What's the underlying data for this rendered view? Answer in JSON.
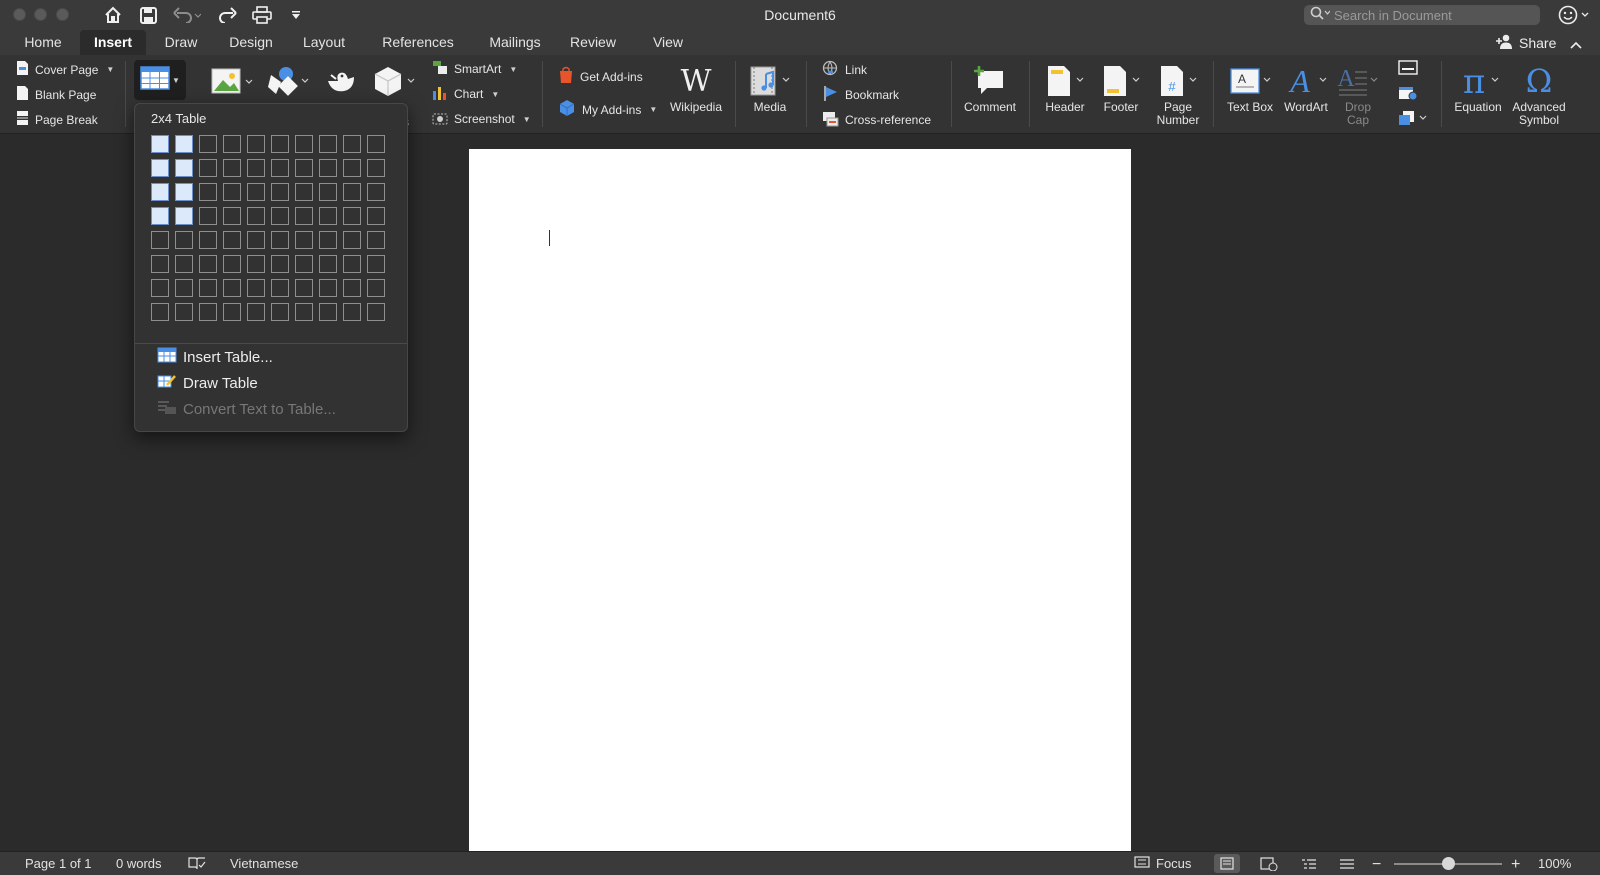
{
  "window": {
    "title": "Document6"
  },
  "search": {
    "placeholder": "Search in Document"
  },
  "tabs": [
    {
      "label": "Home"
    },
    {
      "label": "Insert"
    },
    {
      "label": "Draw"
    },
    {
      "label": "Design"
    },
    {
      "label": "Layout"
    },
    {
      "label": "References"
    },
    {
      "label": "Mailings"
    },
    {
      "label": "Review"
    },
    {
      "label": "View"
    }
  ],
  "active_tab": "Insert",
  "share": {
    "label": "Share"
  },
  "ribbon": {
    "pages": {
      "cover": "Cover Page",
      "blank": "Blank Page",
      "break": "Page Break"
    },
    "smartart": "SmartArt",
    "chart": "Chart",
    "screenshot": "Screenshot",
    "get_addins": "Get Add-ins",
    "my_addins": "My Add-ins",
    "wikipedia": "Wikipedia",
    "media": "Media",
    "link": "Link",
    "bookmark": "Bookmark",
    "cross_reference": "Cross-reference",
    "comment": "Comment",
    "header": "Header",
    "footer": "Footer",
    "page_number": [
      "Page",
      "Number"
    ],
    "text_box": "Text Box",
    "wordart": "WordArt",
    "drop_cap": [
      "Drop",
      "Cap"
    ],
    "equation": "Equation",
    "advanced_symbol": [
      "Advanced",
      "Symbol"
    ],
    "hidden_partial": "s"
  },
  "table_dropdown": {
    "header": "2x4 Table",
    "columns": 10,
    "rows": 8,
    "selected_cols": 2,
    "selected_rows": 4,
    "items": {
      "insert_table": "Insert Table...",
      "draw_table": "Draw Table",
      "convert": "Convert Text to Table..."
    }
  },
  "status": {
    "page": "Page 1 of 1",
    "words": "0 words",
    "language": "Vietnamese",
    "focus": "Focus",
    "zoom": "100%",
    "zoom_level_percent": 100
  },
  "colors": {
    "accent_blue": "#4a8fe3",
    "selection": "#dbe9fb",
    "addins_orange": "#e8542c"
  }
}
